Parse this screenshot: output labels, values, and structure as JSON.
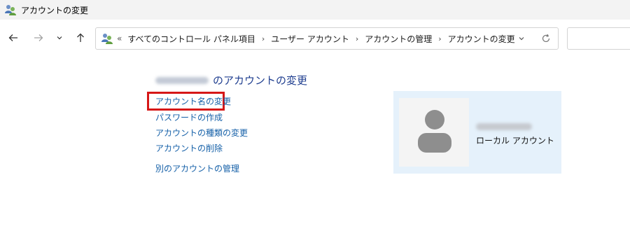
{
  "window": {
    "title": "アカウントの変更",
    "icon": "users-control-panel-icon"
  },
  "nav": {
    "back_icon": "arrow-left-icon",
    "forward_icon": "arrow-right-icon",
    "recent_icon": "chevron-down-icon",
    "up_icon": "arrow-up-icon"
  },
  "address": {
    "overflow": "«",
    "crumbs": [
      "すべてのコントロール パネル項目",
      "ユーザー アカウント",
      "アカウントの管理",
      "アカウントの変更"
    ],
    "separator": "›",
    "dropdown_icon": "chevron-down-icon",
    "refresh_icon": "refresh-icon"
  },
  "main": {
    "heading_suffix": "のアカウントの変更",
    "tasks": [
      "アカウント名の変更",
      "パスワードの作成",
      "アカウントの種類の変更",
      "アカウントの削除"
    ],
    "other_link": "別のアカウントの管理"
  },
  "account": {
    "type": "ローカル アカウント"
  },
  "colors": {
    "link": "#1560a8",
    "heading": "#1e3d8f",
    "highlight": "#d61717",
    "card_bg": "#e5f1fb"
  }
}
